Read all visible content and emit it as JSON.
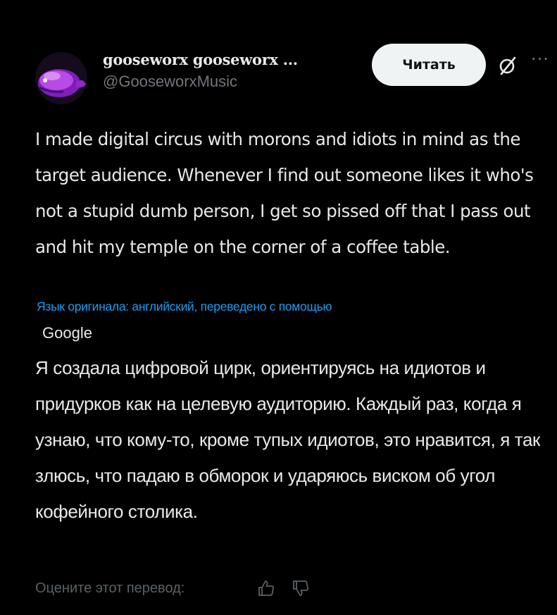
{
  "post": {
    "author": {
      "display_name": "gooseworx gooseworx ...",
      "handle": "@GooseworxMusic"
    },
    "follow_button_label": "Читать",
    "more_label": "···",
    "text": "I made digital circus with morons and idiots in mind as the target audience. Whenever I find out someone likes it who's not a stupid dumb person, I get so pissed off that I pass out and hit my temple on the corner of a coffee table.",
    "translation": {
      "note": "Язык оригинала: английский, переведено с помощью",
      "provider": "Google",
      "text": "Я создала цифровой цирк, ориентируясь на идиотов и придурков как на целевую аудиторию. Каждый раз, когда я узнаю, что кому-то, кроме тупых идиотов, это нравится, я так злюсь, что падаю в обморок и ударяюсь виском об угол кофейного столика.",
      "rate_label": "Оцените этот перевод:"
    }
  },
  "icons": {
    "grok": "grok-icon",
    "more": "more-icon",
    "thumb_up": "thumb-up-icon",
    "thumb_down": "thumb-down-icon"
  },
  "colors": {
    "background": "#000000",
    "text": "#e7e9ea",
    "muted": "#71767b",
    "link": "#1d9bf0",
    "button_bg": "#eff3f4",
    "avatar_accent": "#a23ad8"
  }
}
